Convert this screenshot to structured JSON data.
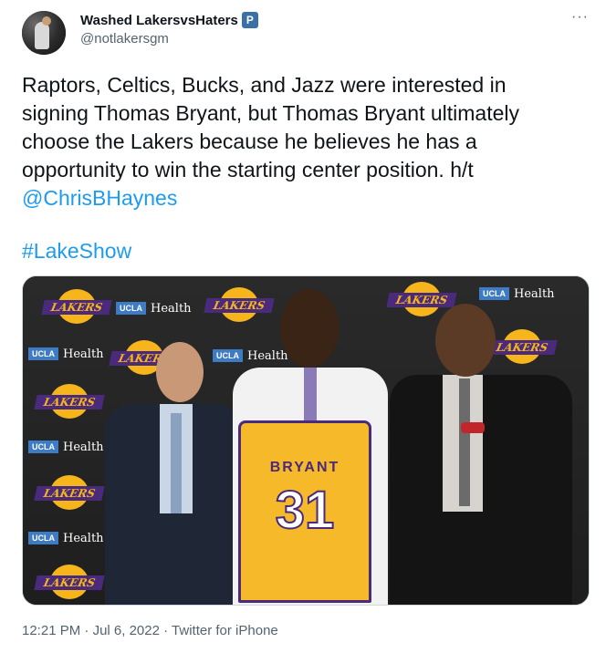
{
  "author": {
    "display_name": "Washed LakersvsHaters",
    "badge": "P",
    "handle": "@notlakersgm"
  },
  "menu": {
    "more_glyph": "···"
  },
  "tweet": {
    "lines": [
      "Raptors, Celtics, Bucks, and Jazz were interested in",
      "signing Thomas Bryant, but Thomas Bryant ultimately",
      "choose the Lakers because he believes he has a",
      "opportunity to win the starting center position. h/t"
    ],
    "mention": "@ChrisBHaynes",
    "hashtag": "#LakeShow"
  },
  "media": {
    "backdrop_logo_text": "LAKERS",
    "sponsor_box": "UCLA",
    "sponsor_word": "Health",
    "jersey_name": "BRYANT",
    "jersey_number": "31"
  },
  "footer": {
    "time": "12:21 PM",
    "date": "Jul 6, 2022",
    "separator": "·",
    "source": "Twitter for iPhone"
  },
  "colors": {
    "link": "#1d9bf0",
    "secondary_text": "#536471",
    "lakers_gold": "#f5b51b",
    "lakers_purple": "#4a2a7c"
  }
}
